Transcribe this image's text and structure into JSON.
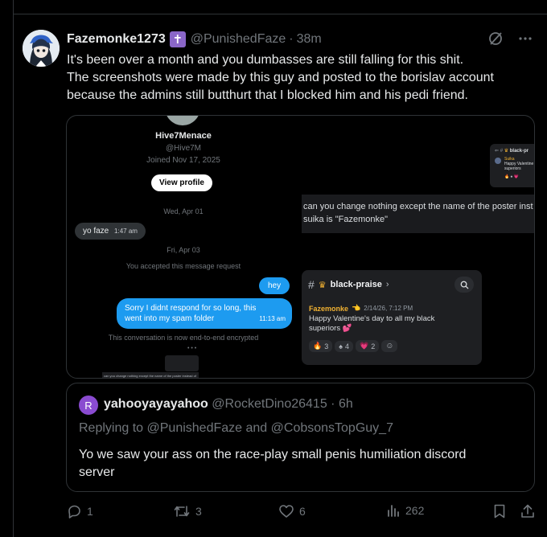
{
  "post": {
    "display_name": "Fazemonke1273",
    "badge_symbol": "✝",
    "handle": "@PunishedFaze",
    "separator": "·",
    "time": "38m",
    "text_line1": "It's been over a month and you dumbasses are still falling for this shit.",
    "text_line2": "The screenshots were made by this guy and posted to the borislav account",
    "text_line3": "because the admins still butthurt that I blocked him and his pedi friend."
  },
  "media": {
    "dm": {
      "profile_name": "Hive7Menace",
      "profile_handle": "@Hive7M",
      "joined": "Joined Nov 17, 2025",
      "view_profile_label": "View profile",
      "date1": "Wed, Apr 01",
      "msg1_text": "yo faze",
      "msg1_time": "1:47 am",
      "date2": "Fri, Apr 03",
      "accepted_notice": "You accepted this message request",
      "msg2_text": "hey",
      "msg3_line1": "Sorry I didnt respond for so long, this",
      "msg3_line2": "went into my spam folder",
      "msg3_time": "11:13 am",
      "encryption_notice": "This conversation is now end-to-end encrypted",
      "tiny_caption": "can you change nothing except the name of the poster instead of"
    },
    "edit_request": {
      "line1": "can you change nothing except the name of the poster inst",
      "line2": "suika is \"Fazemonke\""
    },
    "thumb_top": {
      "channel": "black-pr",
      "user": "Suika",
      "line1": "Happy Valentine",
      "line2": "superiors"
    },
    "discord": {
      "channel_hash": "#",
      "channel_name": "black-praise",
      "channel_chevron": "›",
      "username": "Fazemonke",
      "timestamp": "2/14/26, 7:12 PM",
      "message_line1": "Happy Valentine's day to all my black",
      "message_line2": "superiors",
      "reactions": [
        {
          "emoji": "🔥",
          "count": "3"
        },
        {
          "emoji": "♠",
          "count": "4"
        },
        {
          "emoji": "💗",
          "count": "2"
        }
      ]
    }
  },
  "quote": {
    "avatar_letter": "R",
    "display_name": "yahooyayayahoo",
    "handle": "@RocketDino26415",
    "separator": "·",
    "time": "6h",
    "replying_prefix": "Replying to",
    "reply_to_1": "@PunishedFaze",
    "reply_and": "and",
    "reply_to_2": "@CobsonsTopGuy_7",
    "text_line1": "Yo we saw your ass on the race-play small penis humiliation discord",
    "text_line2": "server"
  },
  "actions": {
    "replies": "1",
    "reposts": "3",
    "likes": "6",
    "views": "262"
  },
  "colors": {
    "accent": "#1d9bf0",
    "text_primary": "#e7e9ea",
    "text_secondary": "#71767b",
    "border": "#2f3336",
    "background": "#000000",
    "badge_purple": "#8a66c8",
    "quote_avatar": "#8a4bd0",
    "discord_username": "#f0b132"
  }
}
